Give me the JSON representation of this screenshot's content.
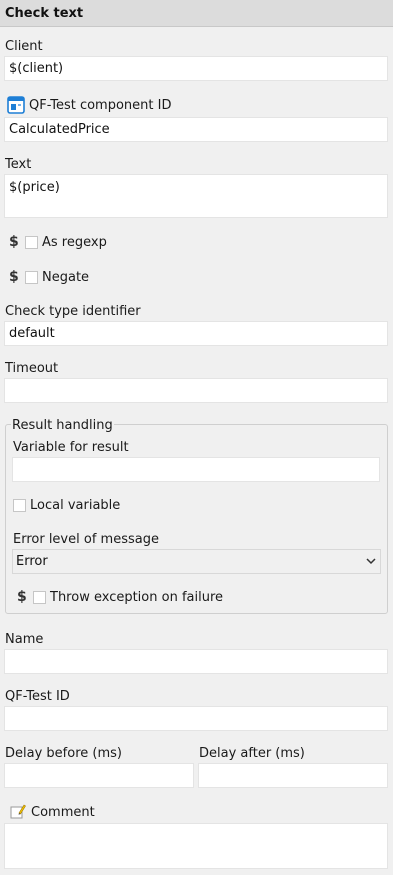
{
  "title": "Check text",
  "client": {
    "label": "Client",
    "value": "$(client)"
  },
  "component": {
    "label": "QF-Test component ID",
    "value": "CalculatedPrice",
    "icon": "component-icon"
  },
  "text": {
    "label": "Text",
    "value": "$(price)"
  },
  "as_regexp": {
    "variable_marker": "$",
    "label": "As regexp",
    "checked": false
  },
  "negate": {
    "variable_marker": "$",
    "label": "Negate",
    "checked": false
  },
  "check_type": {
    "label": "Check type identifier",
    "value": "default"
  },
  "timeout": {
    "label": "Timeout",
    "value": ""
  },
  "result_handling": {
    "legend": "Result handling",
    "variable": {
      "label": "Variable for result",
      "value": ""
    },
    "local_variable": {
      "label": "Local variable",
      "checked": false
    },
    "error_level": {
      "label": "Error level of message",
      "selected": "Error"
    },
    "throw_exception": {
      "variable_marker": "$",
      "label": "Throw exception on failure",
      "checked": false
    }
  },
  "name": {
    "label": "Name",
    "value": ""
  },
  "qftest_id": {
    "label": "QF-Test ID",
    "value": ""
  },
  "delay_before": {
    "label": "Delay before (ms)",
    "value": ""
  },
  "delay_after": {
    "label": "Delay after (ms)",
    "value": ""
  },
  "comment": {
    "label": "Comment",
    "value": "",
    "icon": "pencil-icon"
  },
  "colors": {
    "background": "#f0f0f0",
    "header": "#dcdcdc",
    "field": "#ffffff",
    "icon_blue": "#1e7fd6",
    "pencil_yellow": "#f2c200"
  }
}
